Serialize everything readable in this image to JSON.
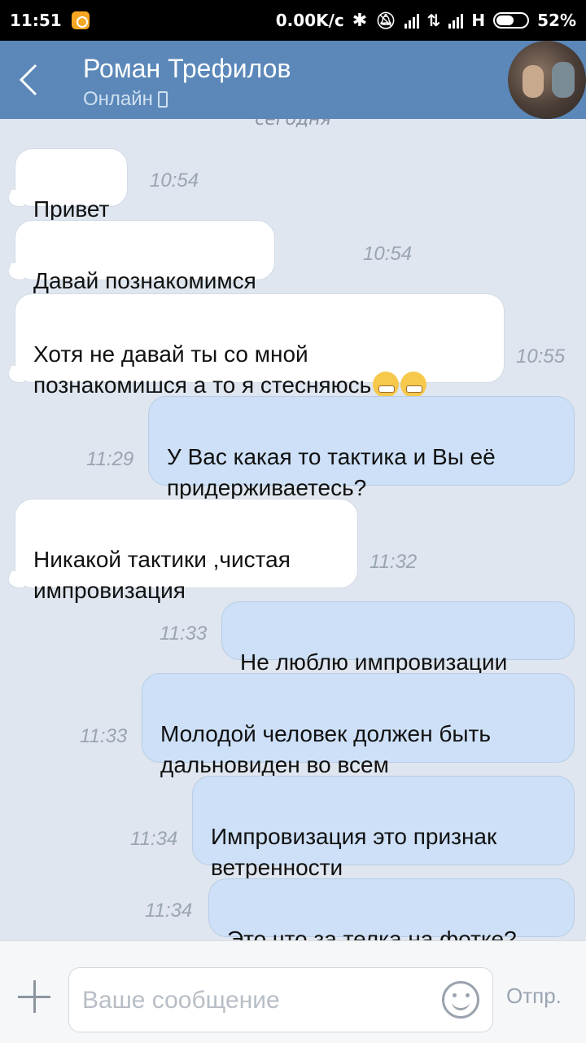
{
  "status_bar": {
    "time": "11:51",
    "speed": "0.00K/c",
    "network": "H",
    "battery": "52%",
    "battery_level": 0.52
  },
  "header": {
    "title": "Роман Трефилов",
    "subtitle": "Онлайн"
  },
  "chat": {
    "date_separator": "сегодня",
    "messages": [
      {
        "dir": "in",
        "text": "Привет",
        "time": "10:54"
      },
      {
        "dir": "in",
        "text": "Давай познакомимся",
        "time": "10:54",
        "emoji": [
          "grin-emoji"
        ]
      },
      {
        "dir": "in",
        "text": "Хотя не давай ты со мной\nпознакомишся а то я стесняюсь",
        "time": "10:55",
        "emoji": [
          "smirk-emoji",
          "grin-emoji"
        ]
      },
      {
        "dir": "out",
        "text": "У Вас какая то тактика и Вы её\nпридерживаетесь?",
        "time": "11:29"
      },
      {
        "dir": "in",
        "text": "Никакой тактики ,чистая\nимпровизация",
        "time": "11:32"
      },
      {
        "dir": "out",
        "text": "Не люблю импровизации",
        "time": "11:33"
      },
      {
        "dir": "out",
        "text": "Молодой человек должен быть\nдальновиден во всем",
        "time": "11:33"
      },
      {
        "dir": "out",
        "text": "Импровизация это признак\nветренности",
        "time": "11:34"
      },
      {
        "dir": "out",
        "text": "Это что за телка на фотке?",
        "time": "11:34"
      }
    ]
  },
  "composer": {
    "placeholder": "Ваше сообщение",
    "send_label": "Отпр."
  },
  "colors": {
    "header_bg": "#5b88b9",
    "incoming_bubble": "#ffffff",
    "outgoing_bubble": "#cde0f7",
    "chat_bg": "#dfe6ef"
  }
}
